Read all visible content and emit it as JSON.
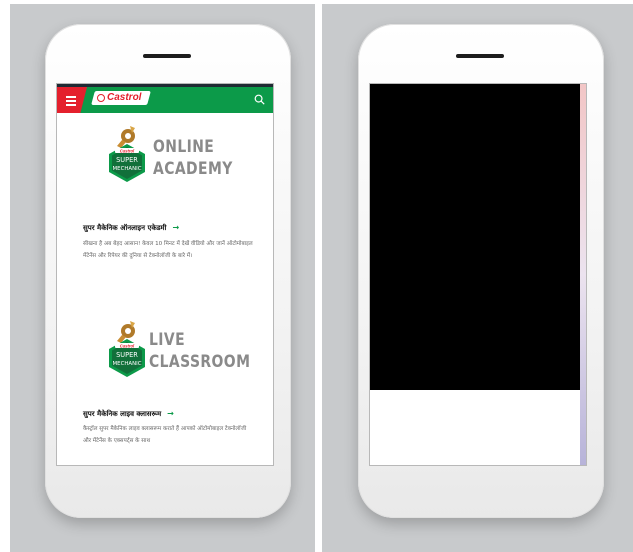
{
  "left_phone": {
    "header": {
      "brand": "Castrol"
    },
    "courses": [
      {
        "badge_text": [
          "Castrol",
          "SUPER",
          "MECHANIC"
        ],
        "title_line1": "ONLINE",
        "title_line2": "ACADEMY",
        "link_label": "सुपर मैकेनिक ऑनलाइन एकेडमी",
        "link_arrow": "→",
        "description": "सीखना है अब बेहद आसान! केवल 10 मिनट में देखें वीडियो और जानें ऑटोमोबाइल मेंटेनेंस और रिपेयर की दुनिया से टेक्नोलॉजी के बारे में।"
      },
      {
        "badge_text": [
          "Castrol",
          "SUPER",
          "MECHANIC"
        ],
        "title_line1": "LIVE",
        "title_line2": "CLASSROOM",
        "link_label": "सुपर मैकेनिक लाइव क्लासरूम",
        "link_arrow": "→",
        "description": "कैस्ट्रॉल सुपर मैकेनिक लाइव क्लासरूम कराते हैं आपको ऑटोमोबाइल टेक्नोलॉजी और मेंटेनेंस के एक्सपर्ट्स के साथ"
      }
    ]
  },
  "right_phone": {},
  "colors": {
    "castrol_green": "#0c9a49",
    "castrol_red": "#e4202d",
    "title_gray": "#8a8a8a",
    "background_gray": "#c8cacc"
  },
  "icons": [
    "menu-icon",
    "search-icon",
    "wrench-gear-icon",
    "arrow-right-icon"
  ]
}
